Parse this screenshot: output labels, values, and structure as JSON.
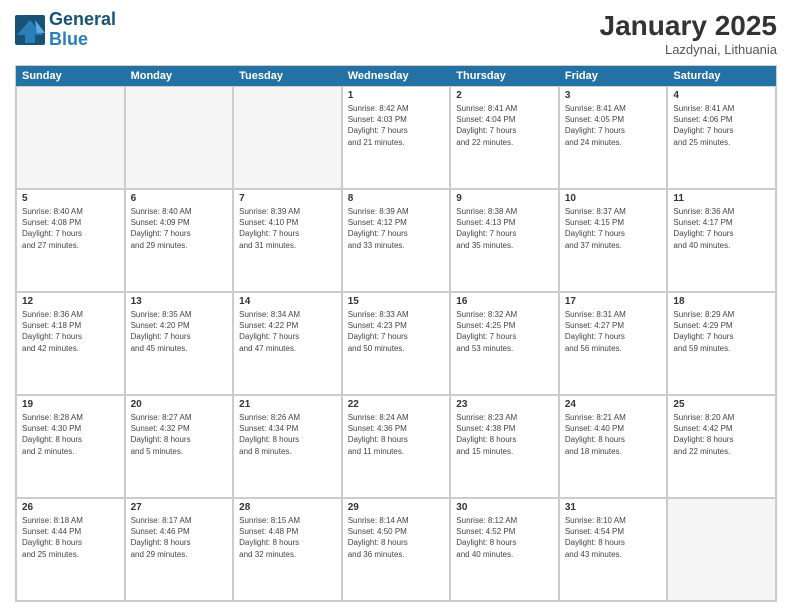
{
  "header": {
    "logo_line1": "General",
    "logo_line2": "Blue",
    "month": "January 2025",
    "location": "Lazdynai, Lithuania"
  },
  "day_headers": [
    "Sunday",
    "Monday",
    "Tuesday",
    "Wednesday",
    "Thursday",
    "Friday",
    "Saturday"
  ],
  "weeks": [
    [
      {
        "date": "",
        "info": ""
      },
      {
        "date": "",
        "info": ""
      },
      {
        "date": "",
        "info": ""
      },
      {
        "date": "1",
        "info": "Sunrise: 8:42 AM\nSunset: 4:03 PM\nDaylight: 7 hours\nand 21 minutes."
      },
      {
        "date": "2",
        "info": "Sunrise: 8:41 AM\nSunset: 4:04 PM\nDaylight: 7 hours\nand 22 minutes."
      },
      {
        "date": "3",
        "info": "Sunrise: 8:41 AM\nSunset: 4:05 PM\nDaylight: 7 hours\nand 24 minutes."
      },
      {
        "date": "4",
        "info": "Sunrise: 8:41 AM\nSunset: 4:06 PM\nDaylight: 7 hours\nand 25 minutes."
      }
    ],
    [
      {
        "date": "5",
        "info": "Sunrise: 8:40 AM\nSunset: 4:08 PM\nDaylight: 7 hours\nand 27 minutes."
      },
      {
        "date": "6",
        "info": "Sunrise: 8:40 AM\nSunset: 4:09 PM\nDaylight: 7 hours\nand 29 minutes."
      },
      {
        "date": "7",
        "info": "Sunrise: 8:39 AM\nSunset: 4:10 PM\nDaylight: 7 hours\nand 31 minutes."
      },
      {
        "date": "8",
        "info": "Sunrise: 8:39 AM\nSunset: 4:12 PM\nDaylight: 7 hours\nand 33 minutes."
      },
      {
        "date": "9",
        "info": "Sunrise: 8:38 AM\nSunset: 4:13 PM\nDaylight: 7 hours\nand 35 minutes."
      },
      {
        "date": "10",
        "info": "Sunrise: 8:37 AM\nSunset: 4:15 PM\nDaylight: 7 hours\nand 37 minutes."
      },
      {
        "date": "11",
        "info": "Sunrise: 8:36 AM\nSunset: 4:17 PM\nDaylight: 7 hours\nand 40 minutes."
      }
    ],
    [
      {
        "date": "12",
        "info": "Sunrise: 8:36 AM\nSunset: 4:18 PM\nDaylight: 7 hours\nand 42 minutes."
      },
      {
        "date": "13",
        "info": "Sunrise: 8:35 AM\nSunset: 4:20 PM\nDaylight: 7 hours\nand 45 minutes."
      },
      {
        "date": "14",
        "info": "Sunrise: 8:34 AM\nSunset: 4:22 PM\nDaylight: 7 hours\nand 47 minutes."
      },
      {
        "date": "15",
        "info": "Sunrise: 8:33 AM\nSunset: 4:23 PM\nDaylight: 7 hours\nand 50 minutes."
      },
      {
        "date": "16",
        "info": "Sunrise: 8:32 AM\nSunset: 4:25 PM\nDaylight: 7 hours\nand 53 minutes."
      },
      {
        "date": "17",
        "info": "Sunrise: 8:31 AM\nSunset: 4:27 PM\nDaylight: 7 hours\nand 56 minutes."
      },
      {
        "date": "18",
        "info": "Sunrise: 8:29 AM\nSunset: 4:29 PM\nDaylight: 7 hours\nand 59 minutes."
      }
    ],
    [
      {
        "date": "19",
        "info": "Sunrise: 8:28 AM\nSunset: 4:30 PM\nDaylight: 8 hours\nand 2 minutes."
      },
      {
        "date": "20",
        "info": "Sunrise: 8:27 AM\nSunset: 4:32 PM\nDaylight: 8 hours\nand 5 minutes."
      },
      {
        "date": "21",
        "info": "Sunrise: 8:26 AM\nSunset: 4:34 PM\nDaylight: 8 hours\nand 8 minutes."
      },
      {
        "date": "22",
        "info": "Sunrise: 8:24 AM\nSunset: 4:36 PM\nDaylight: 8 hours\nand 11 minutes."
      },
      {
        "date": "23",
        "info": "Sunrise: 8:23 AM\nSunset: 4:38 PM\nDaylight: 8 hours\nand 15 minutes."
      },
      {
        "date": "24",
        "info": "Sunrise: 8:21 AM\nSunset: 4:40 PM\nDaylight: 8 hours\nand 18 minutes."
      },
      {
        "date": "25",
        "info": "Sunrise: 8:20 AM\nSunset: 4:42 PM\nDaylight: 8 hours\nand 22 minutes."
      }
    ],
    [
      {
        "date": "26",
        "info": "Sunrise: 8:18 AM\nSunset: 4:44 PM\nDaylight: 8 hours\nand 25 minutes."
      },
      {
        "date": "27",
        "info": "Sunrise: 8:17 AM\nSunset: 4:46 PM\nDaylight: 8 hours\nand 29 minutes."
      },
      {
        "date": "28",
        "info": "Sunrise: 8:15 AM\nSunset: 4:48 PM\nDaylight: 8 hours\nand 32 minutes."
      },
      {
        "date": "29",
        "info": "Sunrise: 8:14 AM\nSunset: 4:50 PM\nDaylight: 8 hours\nand 36 minutes."
      },
      {
        "date": "30",
        "info": "Sunrise: 8:12 AM\nSunset: 4:52 PM\nDaylight: 8 hours\nand 40 minutes."
      },
      {
        "date": "31",
        "info": "Sunrise: 8:10 AM\nSunset: 4:54 PM\nDaylight: 8 hours\nand 43 minutes."
      },
      {
        "date": "",
        "info": ""
      }
    ]
  ]
}
